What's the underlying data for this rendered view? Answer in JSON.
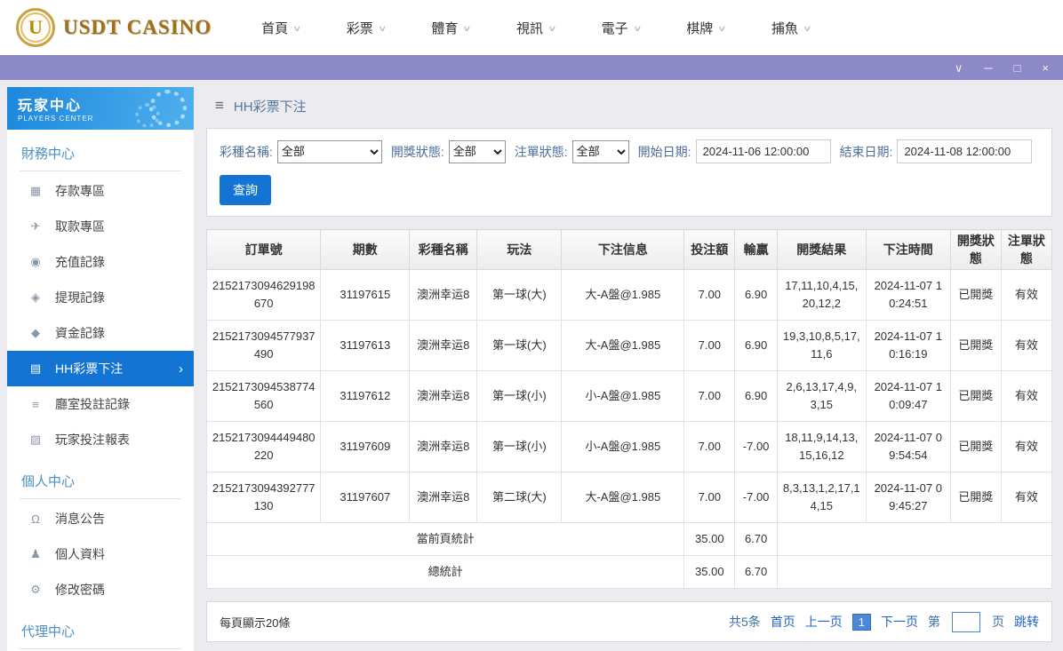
{
  "window": {
    "controls": [
      {
        "name": "chevron-down-icon",
        "glyph": "∨"
      },
      {
        "name": "minimize-icon",
        "glyph": "─"
      },
      {
        "name": "maximize-icon",
        "glyph": "□"
      },
      {
        "name": "close-icon",
        "glyph": "×"
      }
    ]
  },
  "header": {
    "logo": {
      "text": "USDT CASINO",
      "monogram": "U"
    },
    "chevron_glyph": "∨",
    "nav": [
      {
        "label": "首頁"
      },
      {
        "label": "彩票"
      },
      {
        "label": "體育"
      },
      {
        "label": "視訊"
      },
      {
        "label": "電子"
      },
      {
        "label": "棋牌"
      },
      {
        "label": "捕魚"
      }
    ]
  },
  "sidebar": {
    "title": "玩家中心",
    "subtitle": "PLAYERS CENTER",
    "sections": [
      {
        "title": "財務中心",
        "items": [
          {
            "id": "deposit-area",
            "label": "存款專區",
            "icon": "deposit-icon",
            "glyph": "▦"
          },
          {
            "id": "withdraw-area",
            "label": "取款專區",
            "icon": "withdraw-icon",
            "glyph": "✈"
          },
          {
            "id": "recharge-record",
            "label": "充值記錄",
            "icon": "recharge-record-icon",
            "glyph": "◉"
          },
          {
            "id": "withdrawal-record",
            "label": "提現記錄",
            "icon": "withdrawal-record-icon",
            "glyph": "◈"
          },
          {
            "id": "funds-record",
            "label": "資金記錄",
            "icon": "funds-record-icon",
            "glyph": "◆"
          },
          {
            "id": "hh-lottery-bet",
            "label": "HH彩票下注",
            "icon": "lottery-bet-icon",
            "glyph": "▤",
            "active": true
          },
          {
            "id": "hall-bet-record",
            "label": "廳室投註記錄",
            "icon": "hall-bet-record-icon",
            "glyph": "≡"
          },
          {
            "id": "player-bet-report",
            "label": "玩家投注報表",
            "icon": "bet-report-icon",
            "glyph": "▨"
          }
        ]
      },
      {
        "title": "個人中心",
        "items": [
          {
            "id": "message-notice",
            "label": "消息公告",
            "icon": "bell-icon",
            "glyph": "Ω"
          },
          {
            "id": "personal-profile",
            "label": "個人資料",
            "icon": "person-icon",
            "glyph": "♟"
          },
          {
            "id": "change-password",
            "label": "修改密碼",
            "icon": "gear-icon",
            "glyph": "⚙"
          }
        ]
      },
      {
        "title": "代理中心",
        "items": []
      }
    ]
  },
  "main": {
    "breadcrumb": {
      "menu_glyph": "≡",
      "title": "HH彩票下注"
    },
    "filters": {
      "lottery_label": "彩種名稱:",
      "lottery_value": "全部",
      "draw_status_label": "開獎狀態:",
      "draw_status_value": "全部",
      "order_status_label": "注單狀態:",
      "order_status_value": "全部",
      "start_label": "開始日期:",
      "start_value": "2024-11-06 12:00:00",
      "end_label": "結束日期:",
      "end_value": "2024-11-08 12:00:00",
      "search_label": "查詢"
    },
    "table": {
      "headers": [
        "訂單號",
        "期數",
        "彩種名稱",
        "玩法",
        "下注信息",
        "投注額",
        "輸贏",
        "開獎結果",
        "下注時間",
        "開獎狀態",
        "注單狀態"
      ],
      "rows": [
        [
          "2152173094629198670",
          "31197615",
          "澳洲幸运8",
          "第一球(大)",
          "大-A盤@1.985",
          "7.00",
          "6.90",
          "17,11,10,4,15,20,12,2",
          "2024-11-07 10:24:51",
          "已開獎",
          "有效"
        ],
        [
          "2152173094577937490",
          "31197613",
          "澳洲幸运8",
          "第一球(大)",
          "大-A盤@1.985",
          "7.00",
          "6.90",
          "19,3,10,8,5,17,11,6",
          "2024-11-07 10:16:19",
          "已開獎",
          "有效"
        ],
        [
          "2152173094538774560",
          "31197612",
          "澳洲幸运8",
          "第一球(小)",
          "小-A盤@1.985",
          "7.00",
          "6.90",
          "2,6,13,17,4,9,3,15",
          "2024-11-07 10:09:47",
          "已開獎",
          "有效"
        ],
        [
          "2152173094449480220",
          "31197609",
          "澳洲幸运8",
          "第一球(小)",
          "小-A盤@1.985",
          "7.00",
          "-7.00",
          "18,11,9,14,13,15,16,12",
          "2024-11-07 09:54:54",
          "已開獎",
          "有效"
        ],
        [
          "2152173094392777130",
          "31197607",
          "澳洲幸运8",
          "第二球(大)",
          "大-A盤@1.985",
          "7.00",
          "-7.00",
          "8,3,13,1,2,17,14,15",
          "2024-11-07 09:45:27",
          "已開獎",
          "有效"
        ]
      ],
      "page_summary": {
        "label": "當前頁統計",
        "bet": "35.00",
        "win": "6.70"
      },
      "total_summary": {
        "label": "總統計",
        "bet": "35.00",
        "win": "6.70"
      }
    },
    "pagination": {
      "per_page": "每頁顯示20條",
      "total": "共5条",
      "first": "首页",
      "prev": "上一页",
      "current": "1",
      "next": "下一页",
      "jump_prefix": "第",
      "jump_suffix": "页",
      "jump_action": "跳转",
      "jump_value": ""
    }
  },
  "colors": {
    "accent": "#1374d4",
    "purple_bar": "#8d89c6",
    "sidebar_header_blue": "#1d87dc",
    "gold": "#9e701c"
  }
}
